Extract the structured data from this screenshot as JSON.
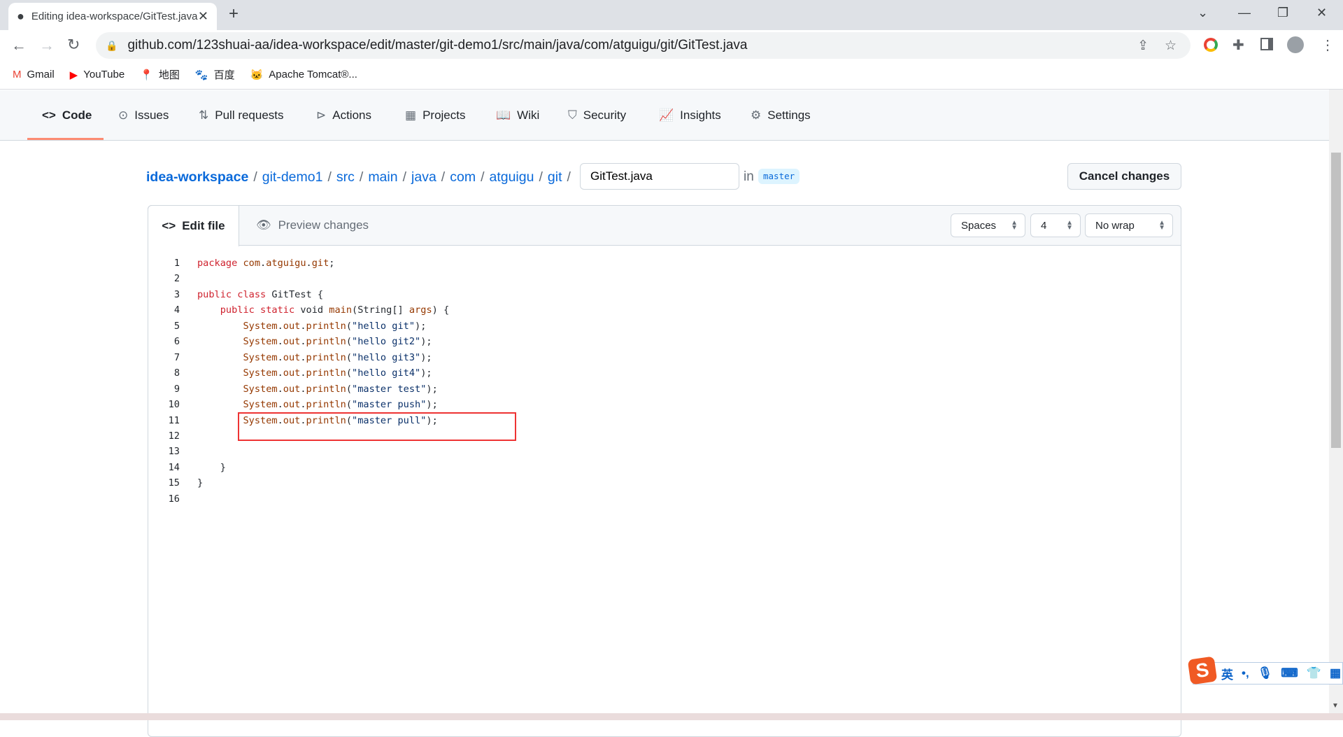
{
  "browser": {
    "tab_title": "Editing idea-workspace/GitTest.java",
    "url": "github.com/123shuai-aa/idea-workspace/edit/master/git-demo1/src/main/java/com/atguigu/git/GitTest.java",
    "bookmarks": [
      {
        "label": "Gmail",
        "icon": "gmail-icon"
      },
      {
        "label": "YouTube",
        "icon": "youtube-icon"
      },
      {
        "label": "地图",
        "icon": "maps-icon"
      },
      {
        "label": "百度",
        "icon": "baidu-icon"
      },
      {
        "label": "Apache Tomcat®...",
        "icon": "tomcat-icon"
      }
    ]
  },
  "repo_nav": [
    {
      "label": "Code",
      "icon": "code-icon",
      "active": true
    },
    {
      "label": "Issues",
      "icon": "issue-icon"
    },
    {
      "label": "Pull requests",
      "icon": "pull-request-icon"
    },
    {
      "label": "Actions",
      "icon": "play-icon"
    },
    {
      "label": "Projects",
      "icon": "table-icon"
    },
    {
      "label": "Wiki",
      "icon": "book-icon"
    },
    {
      "label": "Security",
      "icon": "shield-icon"
    },
    {
      "label": "Insights",
      "icon": "graph-icon"
    },
    {
      "label": "Settings",
      "icon": "gear-icon"
    }
  ],
  "breadcrumb": [
    "idea-workspace",
    "git-demo1",
    "src",
    "main",
    "java",
    "com",
    "atguigu",
    "git"
  ],
  "filename": "GitTest.java",
  "in_label": "in",
  "branch": "master",
  "cancel_label": "Cancel changes",
  "editor": {
    "tab_edit": "Edit file",
    "tab_preview": "Preview changes",
    "indent_mode": "Spaces",
    "indent_size": "4",
    "wrap_mode": "No wrap",
    "lines": [
      "package com.atguigu.git;",
      "",
      "public class GitTest {",
      "    public static void main(String[] args) {",
      "        System.out.println(\"hello git\");",
      "        System.out.println(\"hello git2\");",
      "        System.out.println(\"hello git3\");",
      "        System.out.println(\"hello git4\");",
      "        System.out.println(\"master test\");",
      "        System.out.println(\"master push\");",
      "        System.out.println(\"master pull\");",
      "",
      "",
      "    }",
      "}",
      ""
    ],
    "highlight_color": "#ee3333"
  },
  "ime": {
    "lang": "英"
  }
}
